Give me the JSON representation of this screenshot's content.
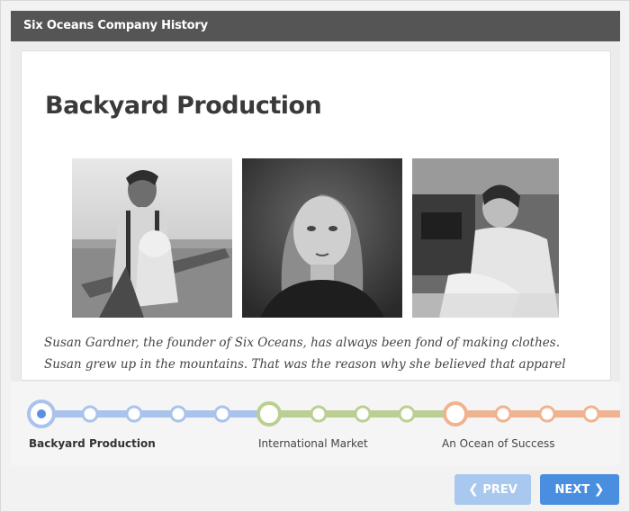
{
  "window": {
    "title": "Six Oceans Company History"
  },
  "slide": {
    "title": "Backyard Production",
    "body": "Susan Gardner, the founder of Six Oceans, has always been fond of making clothes. Susan grew up in the mountains. That was the reason why she believed that apparel should not only be"
  },
  "photos": [
    {
      "icon": "photo-man-with-child-icon"
    },
    {
      "icon": "photo-young-woman-portrait-icon"
    },
    {
      "icon": "photo-woman-sewing-icon"
    }
  ],
  "timeline": {
    "colors": {
      "blue": "#a9c3ec",
      "green": "#bccf92",
      "orange": "#f0b38f",
      "active": "#5b8fe0"
    },
    "labels": [
      "Backyard Production",
      "International Market",
      "An Ocean of Success"
    ],
    "active_index": 0
  },
  "nav": {
    "prev_label": "PREV",
    "next_label": "NEXT",
    "prev_icon": "chevron-left-icon",
    "next_icon": "chevron-right-icon"
  }
}
